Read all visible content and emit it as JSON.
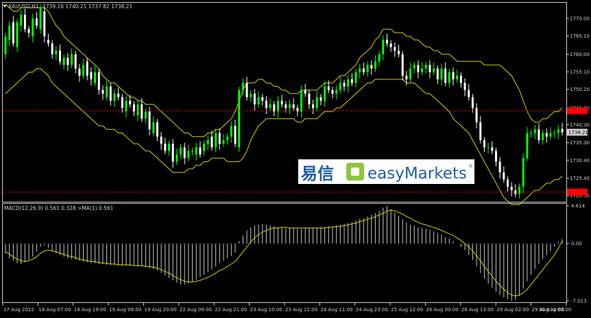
{
  "symbol_label": "XAUUSD,H1",
  "ohlc_values": "1739.16 1740.21 1737.82 1738.21",
  "macd_label": "MACD(12,26,9) 0.561 0.328 >MA(1) 0.561",
  "price_ticks": [
    "1770.00",
    "1765.10",
    "1760.00",
    "1755.10",
    "1750.20",
    "1745.00",
    "1740.30",
    "1735.30",
    "1730.40",
    "1725.40",
    "1720.50"
  ],
  "price_tick_values": [
    1770.0,
    1765.1,
    1760.0,
    1755.1,
    1750.2,
    1745.0,
    1740.3,
    1735.3,
    1730.4,
    1725.4,
    1720.5
  ],
  "current_price": "1738.21",
  "current_price_value": 1738.21,
  "hline_upper_value": 1744.2,
  "hline_lower_value": 1721.5,
  "macd_ticks": [
    "4.614",
    "0.00",
    "-7.013"
  ],
  "macd_tick_values": [
    4.614,
    0.0,
    -7.013
  ],
  "time_labels": [
    "17 Aug 2022",
    "18 Aug 07:00",
    "18 Aug 19:00",
    "19 Aug 08:00",
    "19 Aug 20:00",
    "22 Aug 09:00",
    "22 Aug 21:00",
    "23 Aug 10:00",
    "23 Aug 22:00",
    "24 Aug 11:00",
    "24 Aug 23:00",
    "25 Aug 12:00",
    "26 Aug 00:00",
    "26 Aug 13:00",
    "29 Aug 02:00",
    "29 Aug 14:00",
    "30 Aug 03:00"
  ],
  "watermark": {
    "chinese": "易信",
    "brand": "easyMarkets",
    "reg": "®",
    "brand_color": "#1e5bab",
    "icon_color": "#8dc63f"
  },
  "colors": {
    "bull": "#00ff00",
    "bear": "#ffffff",
    "bands": "#d4d400",
    "signal": "#d4d400",
    "hline": "#ff0000",
    "grid": "#d0d0d0",
    "text": "#d0d0d0",
    "label_bg": "#ff0000"
  },
  "chart_data": {
    "type": "candlestick",
    "ylim": [
      1719,
      1774
    ],
    "macd_ylim": [
      -7.013,
      4.614
    ],
    "close": [
      1765,
      1768,
      1763,
      1769,
      1771,
      1767,
      1766,
      1770,
      1768,
      1773,
      1765,
      1763,
      1760,
      1761,
      1758,
      1759,
      1757,
      1760,
      1756,
      1754,
      1757,
      1754,
      1753,
      1755,
      1750,
      1749,
      1751,
      1747,
      1749,
      1748,
      1745,
      1747,
      1746,
      1744,
      1746,
      1742,
      1744,
      1739,
      1741,
      1737,
      1735,
      1733,
      1735,
      1730,
      1732,
      1734,
      1731,
      1733,
      1733,
      1734,
      1732,
      1735,
      1736,
      1734,
      1738,
      1735,
      1736,
      1737,
      1740,
      1735,
      1750,
      1752,
      1748,
      1749,
      1746,
      1748,
      1747,
      1745,
      1746,
      1744,
      1747,
      1746,
      1745,
      1746,
      1745,
      1744,
      1750,
      1749,
      1746,
      1745,
      1748,
      1747,
      1751,
      1750,
      1749,
      1750,
      1752,
      1751,
      1753,
      1752,
      1755,
      1756,
      1755,
      1757,
      1756,
      1758,
      1760,
      1764,
      1763,
      1762,
      1761,
      1760,
      1754,
      1753,
      1756,
      1757,
      1755,
      1756,
      1757,
      1755,
      1756,
      1753,
      1756,
      1752,
      1755,
      1753,
      1754,
      1752,
      1750,
      1748,
      1745,
      1741,
      1736,
      1734,
      1734,
      1733,
      1730,
      1727,
      1725,
      1723,
      1722,
      1721,
      1723,
      1731,
      1738,
      1738,
      1739,
      1736,
      1738,
      1737,
      1738,
      1738,
      1739,
      1738.21
    ],
    "open": [
      1760,
      1764,
      1769,
      1762,
      1768,
      1771,
      1767,
      1765,
      1770,
      1767,
      1772,
      1764,
      1763,
      1760,
      1761,
      1757,
      1759,
      1757,
      1760,
      1756,
      1754,
      1758,
      1755,
      1752,
      1755,
      1750,
      1748,
      1751,
      1747,
      1749,
      1748,
      1744,
      1747,
      1746,
      1743,
      1746,
      1742,
      1744,
      1738,
      1741,
      1737,
      1735,
      1733,
      1735,
      1730,
      1732,
      1734,
      1731,
      1733,
      1732,
      1734,
      1733,
      1735,
      1737,
      1734,
      1738,
      1735,
      1736,
      1737,
      1740,
      1734,
      1750,
      1752,
      1748,
      1749,
      1746,
      1748,
      1747,
      1745,
      1746,
      1744,
      1747,
      1746,
      1745,
      1746,
      1745,
      1744,
      1750,
      1749,
      1746,
      1745,
      1748,
      1747,
      1751,
      1750,
      1749,
      1750,
      1752,
      1751,
      1753,
      1752,
      1755,
      1756,
      1755,
      1757,
      1756,
      1758,
      1760,
      1764,
      1763,
      1762,
      1761,
      1760,
      1754,
      1753,
      1756,
      1757,
      1755,
      1756,
      1757,
      1755,
      1756,
      1753,
      1756,
      1752,
      1755,
      1753,
      1754,
      1752,
      1750,
      1748,
      1745,
      1741,
      1736,
      1734,
      1734,
      1733,
      1730,
      1727,
      1725,
      1723,
      1722,
      1721,
      1723,
      1731,
      1738,
      1738,
      1739,
      1736,
      1738,
      1737,
      1738,
      1738,
      1739.16
    ],
    "upper_band": [
      1774,
      1773,
      1772,
      1772,
      1773,
      1773,
      1773,
      1773,
      1773,
      1773,
      1773,
      1772,
      1770,
      1768,
      1767,
      1765,
      1764,
      1763,
      1762,
      1761,
      1760,
      1759,
      1758,
      1757,
      1756,
      1754,
      1753,
      1752,
      1752,
      1751,
      1750,
      1749,
      1748,
      1748,
      1747,
      1747,
      1746,
      1746,
      1746,
      1745,
      1744,
      1743,
      1742,
      1741,
      1740,
      1739,
      1738,
      1738,
      1737,
      1737,
      1737,
      1737,
      1738,
      1738,
      1739,
      1739,
      1740,
      1741,
      1742,
      1744,
      1747,
      1750,
      1752,
      1752,
      1752,
      1753,
      1753,
      1752,
      1752,
      1751,
      1751,
      1750,
      1750,
      1749,
      1749,
      1749,
      1750,
      1750,
      1750,
      1750,
      1750,
      1751,
      1752,
      1752,
      1752,
      1753,
      1754,
      1754,
      1755,
      1756,
      1757,
      1759,
      1760,
      1761,
      1762,
      1764,
      1765,
      1767,
      1767,
      1767,
      1766,
      1766,
      1766,
      1765,
      1765,
      1764,
      1764,
      1763,
      1762,
      1762,
      1761,
      1761,
      1760,
      1760,
      1760,
      1759,
      1758,
      1758,
      1758,
      1758,
      1758,
      1758,
      1758,
      1757,
      1757,
      1757,
      1757,
      1757,
      1756,
      1755,
      1754,
      1752,
      1750,
      1747,
      1744,
      1742,
      1741,
      1741,
      1742,
      1742,
      1743,
      1744,
      1744,
      1745
    ],
    "lower_band": [
      1749,
      1750,
      1751,
      1752,
      1753,
      1754,
      1755,
      1755,
      1756,
      1756,
      1755,
      1754,
      1752,
      1751,
      1750,
      1749,
      1748,
      1747,
      1746,
      1745,
      1744,
      1743,
      1742,
      1741,
      1740,
      1740,
      1739,
      1739,
      1739,
      1738,
      1738,
      1737,
      1736,
      1735,
      1735,
      1734,
      1733,
      1733,
      1732,
      1731,
      1730,
      1729,
      1728,
      1727,
      1727,
      1727,
      1727,
      1728,
      1728,
      1729,
      1729,
      1730,
      1730,
      1731,
      1731,
      1731,
      1731,
      1730,
      1730,
      1730,
      1730,
      1731,
      1733,
      1736,
      1738,
      1740,
      1741,
      1742,
      1742,
      1742,
      1742,
      1742,
      1742,
      1742,
      1742,
      1741,
      1741,
      1742,
      1742,
      1742,
      1742,
      1743,
      1744,
      1744,
      1744,
      1745,
      1745,
      1746,
      1747,
      1748,
      1749,
      1750,
      1751,
      1752,
      1752,
      1753,
      1753,
      1753,
      1753,
      1753,
      1753,
      1753,
      1753,
      1752,
      1752,
      1752,
      1751,
      1750,
      1749,
      1749,
      1748,
      1747,
      1746,
      1745,
      1744,
      1742,
      1741,
      1740,
      1739,
      1738,
      1736,
      1734,
      1732,
      1730,
      1728,
      1726,
      1724,
      1722,
      1720,
      1719,
      1718,
      1718,
      1718,
      1719,
      1720,
      1721,
      1722,
      1722,
      1723,
      1724,
      1724,
      1725,
      1725,
      1726
    ],
    "macd_hist": [
      -1.2,
      -1.8,
      -2.1,
      -2.4,
      -2.5,
      -2.3,
      -2.0,
      -1.6,
      -1.0,
      -0.4,
      -0.2,
      -0.5,
      -0.9,
      -1.2,
      -1.4,
      -1.6,
      -1.8,
      -1.9,
      -2.0,
      -2.1,
      -2.2,
      -2.3,
      -2.4,
      -2.4,
      -2.5,
      -2.5,
      -2.6,
      -2.6,
      -2.6,
      -2.7,
      -2.7,
      -2.7,
      -2.7,
      -2.7,
      -2.8,
      -2.8,
      -2.9,
      -3.0,
      -3.1,
      -3.3,
      -3.6,
      -3.9,
      -4.2,
      -4.5,
      -4.8,
      -5.0,
      -5.0,
      -4.9,
      -4.7,
      -4.4,
      -4.1,
      -3.8,
      -3.5,
      -3.2,
      -2.8,
      -2.4,
      -2.1,
      -1.8,
      -1.5,
      -1.1,
      0.3,
      1.0,
      1.6,
      2.0,
      2.2,
      2.3,
      2.4,
      2.3,
      2.2,
      2.1,
      2.0,
      2.0,
      1.9,
      1.9,
      1.9,
      1.8,
      1.8,
      1.9,
      1.9,
      1.9,
      1.9,
      2.0,
      2.0,
      2.1,
      2.1,
      2.2,
      2.3,
      2.4,
      2.5,
      2.6,
      2.8,
      3.0,
      3.1,
      3.3,
      3.5,
      3.7,
      4.0,
      4.4,
      4.6,
      4.2,
      3.8,
      3.4,
      3.0,
      2.6,
      2.3,
      2.2,
      2.0,
      1.9,
      1.8,
      1.7,
      1.5,
      1.3,
      1.1,
      0.8,
      0.6,
      0.3,
      0.0,
      -0.4,
      -0.8,
      -1.4,
      -2.0,
      -2.8,
      -3.6,
      -4.3,
      -4.9,
      -5.4,
      -5.9,
      -6.3,
      -6.6,
      -6.8,
      -7.0,
      -6.9,
      -6.4,
      -5.5,
      -4.6,
      -3.8,
      -3.1,
      -2.5,
      -1.9,
      -1.4,
      -0.9,
      -0.4,
      0.2,
      0.561
    ],
    "macd_signal": [
      -1.0,
      -1.3,
      -1.6,
      -1.9,
      -2.1,
      -2.2,
      -2.1,
      -1.9,
      -1.6,
      -1.2,
      -0.9,
      -0.8,
      -0.9,
      -1.0,
      -1.2,
      -1.3,
      -1.5,
      -1.6,
      -1.7,
      -1.9,
      -2.0,
      -2.1,
      -2.2,
      -2.2,
      -2.3,
      -2.4,
      -2.4,
      -2.5,
      -2.5,
      -2.6,
      -2.6,
      -2.6,
      -2.6,
      -2.7,
      -2.7,
      -2.7,
      -2.8,
      -2.8,
      -2.9,
      -3.0,
      -3.2,
      -3.4,
      -3.6,
      -3.9,
      -4.2,
      -4.4,
      -4.6,
      -4.7,
      -4.7,
      -4.6,
      -4.5,
      -4.3,
      -4.1,
      -3.9,
      -3.6,
      -3.3,
      -3.1,
      -2.8,
      -2.5,
      -2.2,
      -1.6,
      -1.0,
      -0.4,
      0.2,
      0.7,
      1.1,
      1.4,
      1.6,
      1.8,
      1.9,
      1.9,
      2.0,
      2.0,
      1.9,
      1.9,
      1.9,
      1.9,
      1.9,
      1.9,
      1.9,
      1.9,
      1.9,
      1.9,
      2.0,
      2.0,
      2.1,
      2.1,
      2.2,
      2.3,
      2.4,
      2.5,
      2.7,
      2.8,
      3.0,
      3.1,
      3.3,
      3.5,
      3.7,
      4.0,
      4.1,
      4.0,
      3.8,
      3.6,
      3.3,
      3.1,
      2.8,
      2.6,
      2.4,
      2.3,
      2.1,
      2.0,
      1.8,
      1.6,
      1.4,
      1.2,
      1.0,
      0.7,
      0.4,
      0.0,
      -0.4,
      -0.9,
      -1.5,
      -2.1,
      -2.8,
      -3.4,
      -4.0,
      -4.6,
      -5.1,
      -5.6,
      -6.0,
      -6.3,
      -6.4,
      -6.3,
      -6.0,
      -5.6,
      -5.0,
      -4.4,
      -3.8,
      -3.2,
      -2.6,
      -2.0,
      -1.4,
      -0.6,
      0.328
    ]
  }
}
